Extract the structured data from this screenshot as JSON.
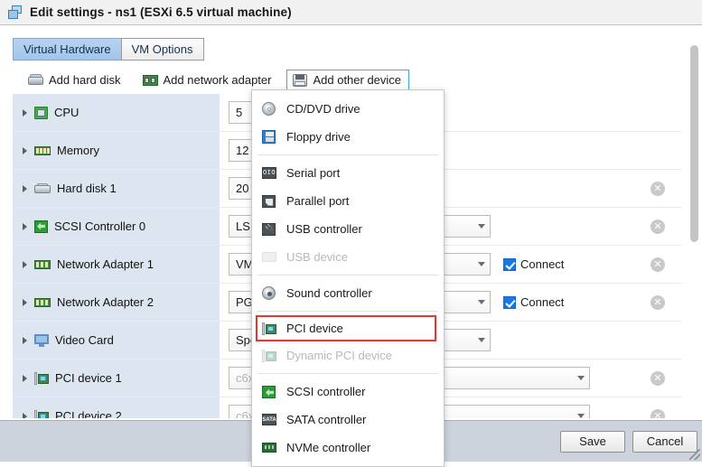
{
  "window": {
    "title": "Edit settings - ns1 (ESXi 6.5 virtual machine)",
    "title_icon": "vm-windows-icon"
  },
  "tabs": [
    {
      "label": "Virtual Hardware",
      "active": true
    },
    {
      "label": "VM Options",
      "active": false
    }
  ],
  "toolbar": {
    "add_hard_disk": "Add hard disk",
    "add_network_adapter": "Add network adapter",
    "add_other_device": "Add other device"
  },
  "devices": [
    {
      "name": "CPU",
      "icon": "cpu-icon",
      "value": "5",
      "field": "num"
    },
    {
      "name": "Memory",
      "icon": "memory-icon",
      "value": "12",
      "field": "num"
    },
    {
      "name": "Hard disk 1",
      "icon": "hard-disk-icon",
      "value": "20",
      "field": "num",
      "deletable": true
    },
    {
      "name": "SCSI Controller 0",
      "icon": "scsi-controller-icon",
      "value": "LSI Logic SAS",
      "field": "select",
      "deletable": true
    },
    {
      "name": "Network Adapter 1",
      "icon": "network-adapter-icon",
      "value": "VM Network",
      "field": "select",
      "connect": "Connect",
      "connected": true,
      "deletable": true
    },
    {
      "name": "Network Adapter 2",
      "icon": "network-adapter-icon",
      "value": "PG1",
      "field": "select",
      "connect": "Connect",
      "connected": true,
      "deletable": true
    },
    {
      "name": "Video Card",
      "icon": "video-card-icon",
      "value": "Specify custom settings",
      "field": "select"
    },
    {
      "name": "PCI device 1",
      "icon": "pci-device-icon",
      "value": "c6xx",
      "field": "select-placeholder",
      "deletable": true
    },
    {
      "name": "PCI device 2",
      "icon": "pci-device-icon",
      "value": "c6xx",
      "field": "select-placeholder",
      "deletable": true
    }
  ],
  "menu": {
    "items": [
      {
        "label": "CD/DVD drive",
        "icon": "cd-dvd-icon",
        "state": "normal"
      },
      {
        "label": "Floppy drive",
        "icon": "floppy-icon",
        "state": "normal"
      },
      {
        "separator_after": true
      },
      {
        "label": "Serial port",
        "icon": "serial-port-icon",
        "state": "normal"
      },
      {
        "label": "Parallel port",
        "icon": "parallel-port-icon",
        "state": "normal"
      },
      {
        "label": "USB controller",
        "icon": "usb-controller-icon",
        "state": "normal"
      },
      {
        "label": "USB device",
        "icon": "usb-device-icon",
        "state": "disabled",
        "separator_after": true
      },
      {
        "label": "Sound controller",
        "icon": "sound-controller-icon",
        "state": "normal",
        "separator_after": true
      },
      {
        "label": "PCI device",
        "icon": "pci-device-icon",
        "state": "selected"
      },
      {
        "label": "Dynamic PCI device",
        "icon": "pci-device-icon",
        "state": "disabled",
        "separator_after": true
      },
      {
        "label": "SCSI controller",
        "icon": "scsi-controller-icon",
        "state": "normal"
      },
      {
        "label": "SATA controller",
        "icon": "sata-controller-icon",
        "state": "normal"
      },
      {
        "label": "NVMe controller",
        "icon": "nvme-controller-icon",
        "state": "normal"
      }
    ]
  },
  "footer": {
    "save_label": "Save",
    "cancel_label": "Cancel"
  },
  "colors": {
    "row_name_bg": "#dde6f0",
    "active_tab": "#a2c4ea",
    "selection_outline": "#e03b32",
    "toolbar_highlight": "#3aaee0",
    "checkbox_accent": "#1779e4",
    "footer_bg": "#ccd3dc"
  },
  "sata_icon_text": "SATA",
  "serial_icon_text": "OIO",
  "delete_glyph": "✕"
}
